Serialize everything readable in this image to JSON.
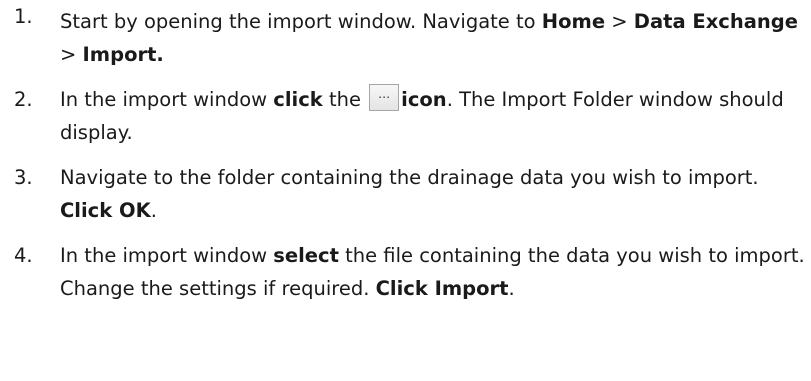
{
  "steps": [
    {
      "number": "1.",
      "text_1": "Start by opening the import window. Navigate to ",
      "bold_1": "Home",
      "text_2": " > ",
      "bold_2": "Data Exchange",
      "text_3": " > ",
      "bold_3": "Import."
    },
    {
      "number": "2.",
      "text_1": "In the import window ",
      "bold_1": "click",
      "text_2": " the ",
      "icon_glyph": "…",
      "icon_name": "browse-ellipsis-icon",
      "bold_2": "icon",
      "text_3": ". The Import Folder window should display."
    },
    {
      "number": "3.",
      "text_1": "Navigate to the folder containing the drainage data you wish to import. ",
      "bold_1": "Click OK",
      "text_2": "."
    },
    {
      "number": "4.",
      "text_1": "In the import window ",
      "bold_1": "select",
      "text_2": " the file containing the data you wish to import. Change the settings if required. ",
      "bold_2": "Click Import",
      "text_3": "."
    }
  ]
}
